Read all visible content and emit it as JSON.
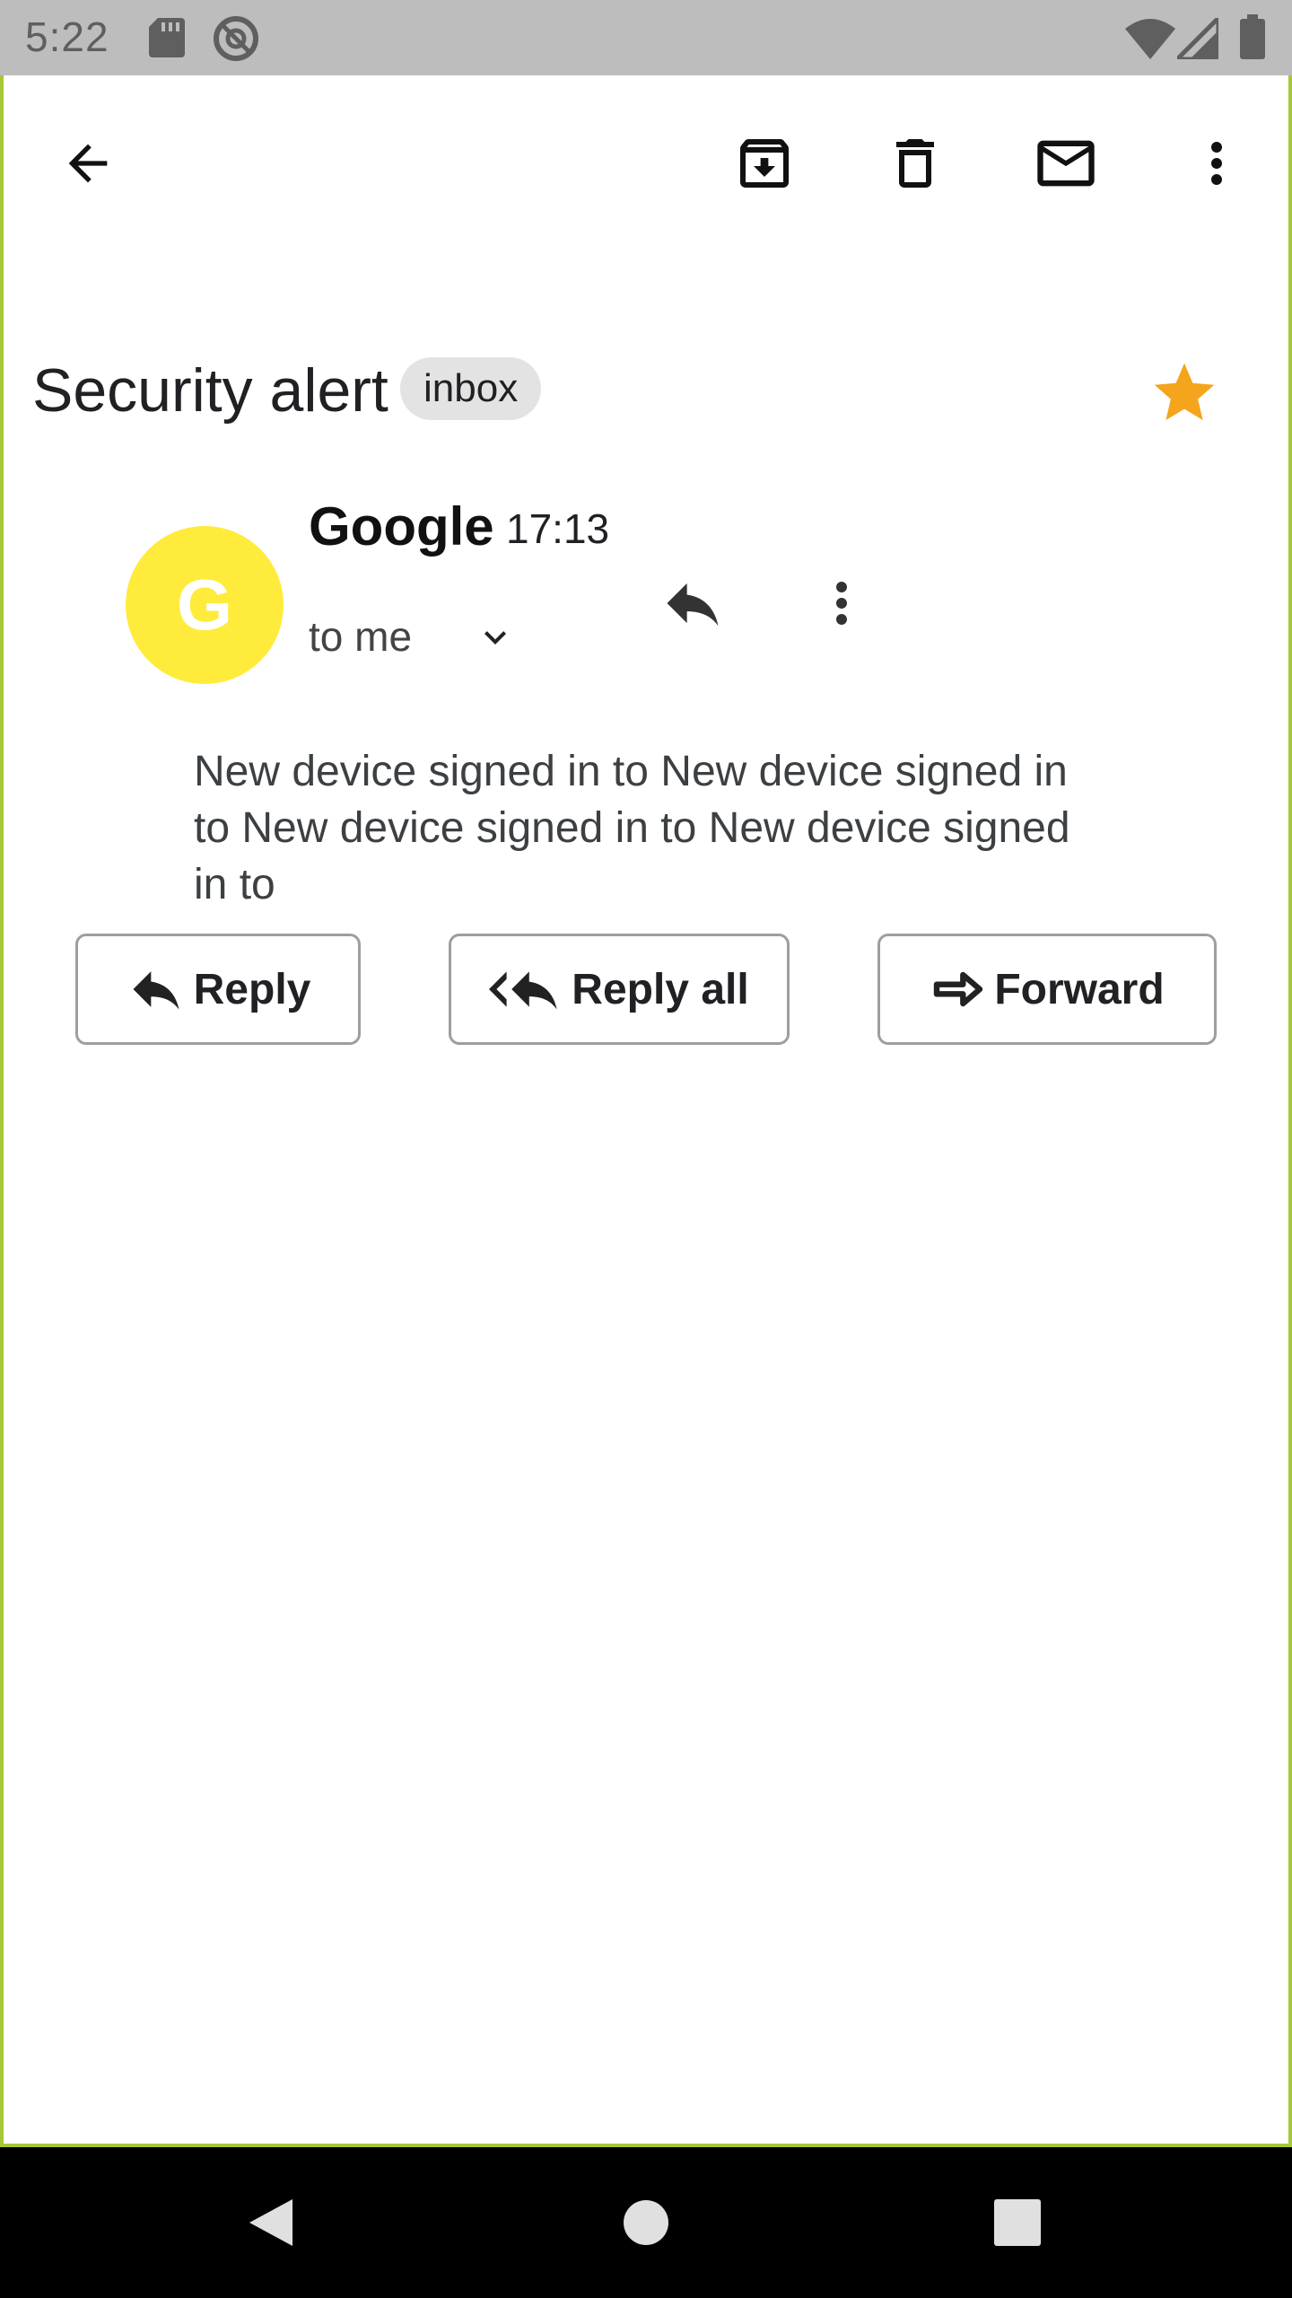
{
  "status_bar": {
    "time": "5:22",
    "icons": [
      "sd-card-icon",
      "data-saver-icon",
      "wifi-icon",
      "signal-icon",
      "battery-icon"
    ]
  },
  "toolbar": {
    "icons": [
      "back-arrow-icon",
      "archive-icon",
      "delete-icon",
      "mark-unread-icon",
      "more-vert-icon"
    ]
  },
  "email": {
    "subject": "Security alert",
    "label": "inbox",
    "starred": true,
    "star_color": "#f4a51c",
    "sender": {
      "name": "Google",
      "initial": "G",
      "avatar_color": "#ffeb3b",
      "time": "17:13",
      "recipient": "to me"
    },
    "body": "New device signed in to New device signed in to New device signed in to New device signed in to"
  },
  "actions": {
    "reply": "Reply",
    "reply_all": "Reply all",
    "forward": "Forward"
  },
  "nav": {
    "icons": [
      "nav-back-icon",
      "nav-home-icon",
      "nav-recents-icon"
    ]
  },
  "colors": {
    "frame_border": "#a6c736",
    "status_bar_bg": "#bdbdbd",
    "chip_bg": "#e3e3e3"
  }
}
